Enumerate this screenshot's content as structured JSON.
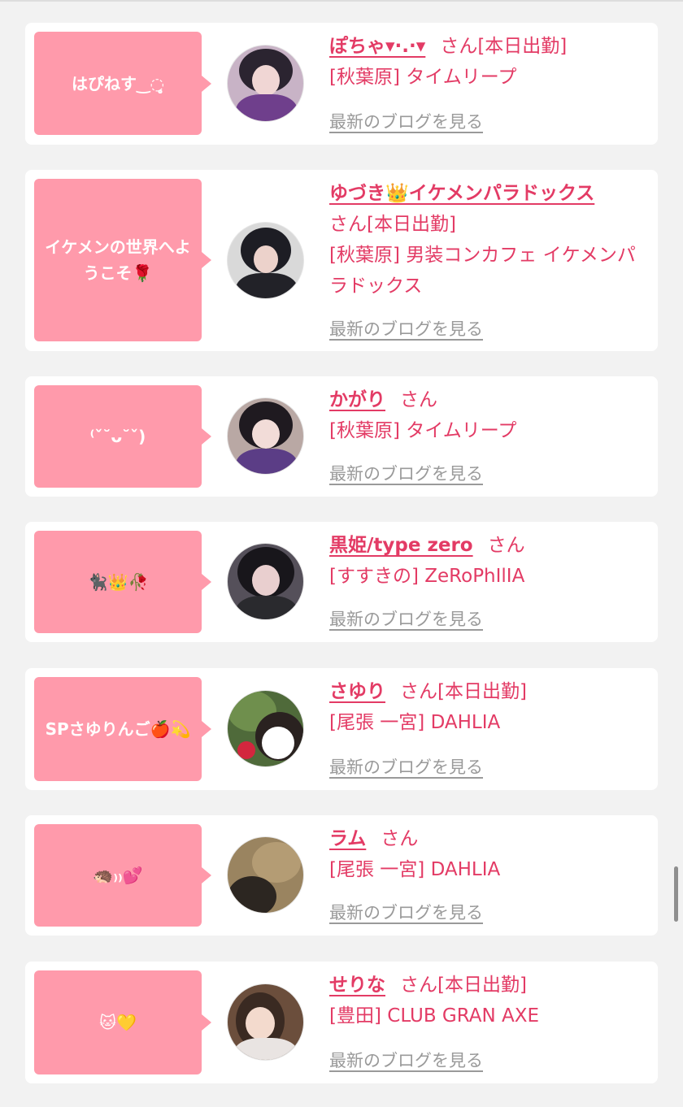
{
  "colors": {
    "bubble": "#ff9aab",
    "accent": "#e33b65",
    "link_gray": "#9a9a9a"
  },
  "cards": [
    {
      "message": "はぴねす‿◌̥̥̥̥̥̥̥̥̥̥̥̥̥̥̥̥̥̥̥̥̥̥̥̥̥̥",
      "name": "ぽちゃ▾·.·▾",
      "san": "さん",
      "status": "[本日出勤]",
      "area": "[秋葉原]",
      "shop": "タイムリープ",
      "blog": "最新のブログを見る",
      "avatar_icon": "profile-photo"
    },
    {
      "message": "イケメンの世界へようこそ🌹",
      "name": "ゆづき👑イケメンパラドックス",
      "san": "さん",
      "status": "[本日出勤]",
      "area": "[秋葉原]",
      "shop": "男装コンカフェ イケメンパラドックス",
      "blog": "最新のブログを見る",
      "avatar_icon": "profile-photo"
    },
    {
      "message": "⁽ˇ˘ᴗ˘ˇ)",
      "name": "かがり",
      "san": "さん",
      "status": "",
      "area": "[秋葉原]",
      "shop": "タイムリープ",
      "blog": "最新のブログを見る",
      "avatar_icon": "profile-photo"
    },
    {
      "message": "🐈‍⬛👑🥀",
      "name": "黒姫/type zero",
      "san": "さん",
      "status": "",
      "area": "[すすきの]",
      "shop": "ZeRoPhIlIA",
      "blog": "最新のブログを見る",
      "avatar_icon": "profile-photo"
    },
    {
      "message": "SPさゆりんご🍎💫",
      "name": "さゆり",
      "san": "さん",
      "status": "[本日出勤]",
      "area": "[尾張 一宮]",
      "shop": "DAHLIA",
      "blog": "最新のブログを見る",
      "avatar_icon": "profile-photo"
    },
    {
      "message": "🦔₎₎💕",
      "name": "ラム",
      "san": "さん",
      "status": "",
      "area": "[尾張 一宮]",
      "shop": "DAHLIA",
      "blog": "最新のブログを見る",
      "avatar_icon": "profile-photo"
    },
    {
      "message": "🐱💛",
      "name": "せりな",
      "san": "さん",
      "status": "[本日出勤]",
      "area": "[豊田]",
      "shop": "CLUB GRAN AXE",
      "blog": "最新のブログを見る",
      "avatar_icon": "profile-photo"
    }
  ]
}
